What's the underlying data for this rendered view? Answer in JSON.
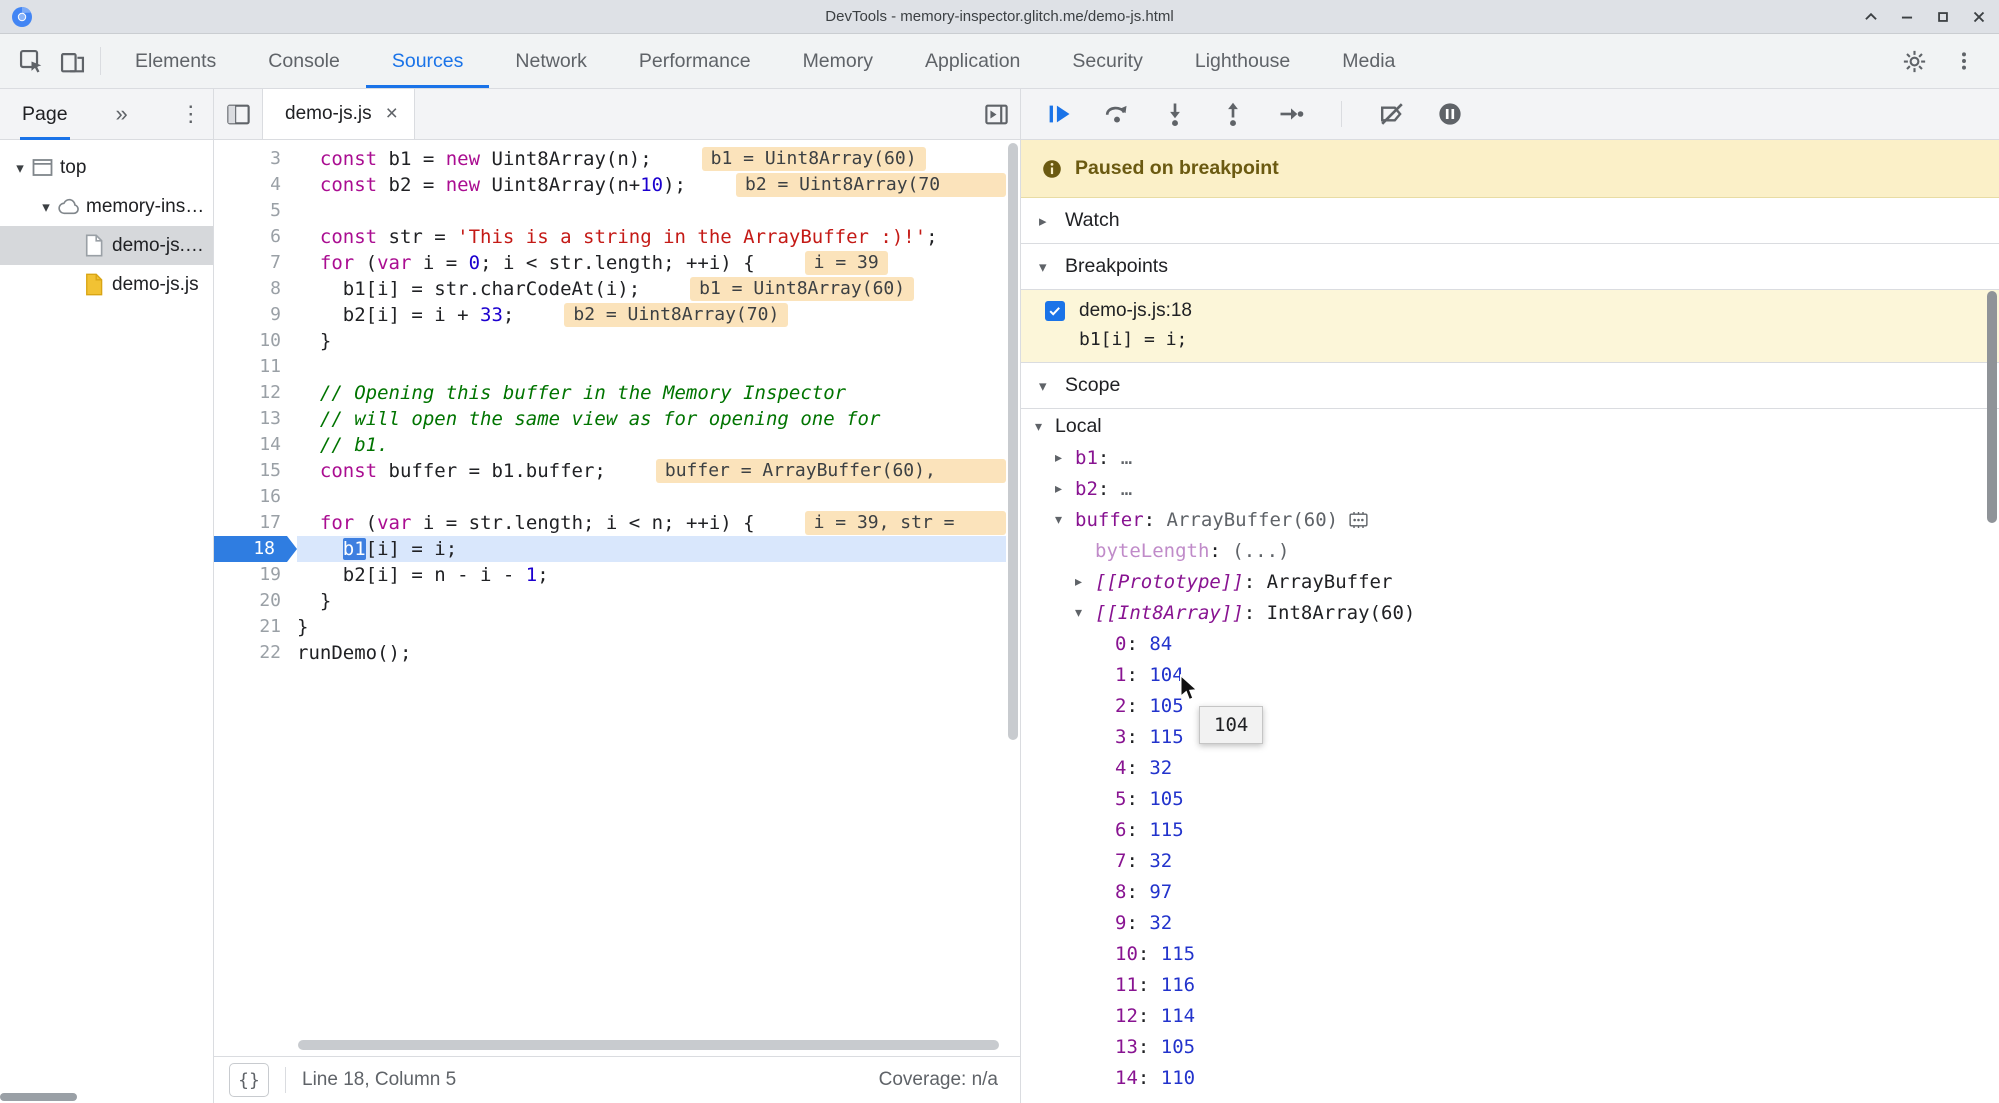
{
  "window": {
    "title": "DevTools - memory-inspector.glitch.me/demo-js.html",
    "controls": [
      "keep-on-top-icon",
      "minimize-icon",
      "maximize-icon",
      "close-icon"
    ]
  },
  "colors": {
    "accent": "#1a73e8",
    "keyword": "#aa0d91",
    "number": "#1c00cf",
    "string": "#c41a16",
    "comment": "#007400",
    "badge_bg": "#fbe3bb",
    "paused_bg": "#fbf0c8",
    "paused_text": "#6b5a11",
    "breakpoint_bg": "#fcf6d9",
    "current_line_bg": "#d9e7fc",
    "selection_bg": "#3e7fe0",
    "prop_name": "#881391",
    "getter_name": "#c08bc9",
    "value_number": "#2233cc",
    "selected_row_bg": "#d6d8db"
  },
  "toolbar": {
    "left_icons": [
      "inspect-icon",
      "device-toolbar-icon"
    ],
    "tabs": [
      {
        "label": "Elements"
      },
      {
        "label": "Console"
      },
      {
        "label": "Sources",
        "active": true
      },
      {
        "label": "Network"
      },
      {
        "label": "Performance"
      },
      {
        "label": "Memory"
      },
      {
        "label": "Application"
      },
      {
        "label": "Security"
      },
      {
        "label": "Lighthouse"
      },
      {
        "label": "Media"
      }
    ],
    "right_icons": [
      "settings-icon",
      "more-menu-icon"
    ]
  },
  "navigator": {
    "tab": "Page",
    "more": "»",
    "menu": "⋮",
    "tree": [
      {
        "label": "top",
        "depth": 0,
        "icon": "frame-icon",
        "expanded": true
      },
      {
        "label": "memory-inspector.glitch.me",
        "depth": 1,
        "icon": "cloud-icon",
        "expanded": true
      },
      {
        "label": "demo-js.html",
        "depth": 2,
        "icon": "file-html-icon",
        "selected": true
      },
      {
        "label": "demo-js.js",
        "depth": 2,
        "icon": "file-js-icon"
      }
    ]
  },
  "editor": {
    "tab": {
      "label": "demo-js.js",
      "close": "×"
    },
    "status": {
      "pretty": "{}",
      "position": "Line 18, Column 5",
      "coverage": "Coverage: n/a"
    },
    "lines": [
      {
        "n": 3,
        "s": [
          [
            "pl",
            "  "
          ],
          [
            "kw",
            "const"
          ],
          [
            "pl",
            " b1 = "
          ],
          [
            "kw",
            "new"
          ],
          [
            "pl",
            " Uint8Array(n);"
          ]
        ],
        "b": "b1 = Uint8Array(60)"
      },
      {
        "n": 4,
        "s": [
          [
            "pl",
            "  "
          ],
          [
            "kw",
            "const"
          ],
          [
            "pl",
            " b2 = "
          ],
          [
            "kw",
            "new"
          ],
          [
            "pl",
            " Uint8Array(n+"
          ],
          [
            "num",
            "10"
          ],
          [
            "pl",
            ");"
          ]
        ],
        "b": "b2 = Uint8Array(70",
        "cut": true
      },
      {
        "n": 5,
        "s": []
      },
      {
        "n": 6,
        "s": [
          [
            "pl",
            "  "
          ],
          [
            "kw",
            "const"
          ],
          [
            "pl",
            " str = "
          ],
          [
            "str",
            "'This is a string in the ArrayBuffer :)!'"
          ],
          [
            "pl",
            ";"
          ]
        ]
      },
      {
        "n": 7,
        "s": [
          [
            "pl",
            "  "
          ],
          [
            "kw",
            "for"
          ],
          [
            "pl",
            " ("
          ],
          [
            "kw",
            "var"
          ],
          [
            "pl",
            " i = "
          ],
          [
            "num",
            "0"
          ],
          [
            "pl",
            "; i < str.length; ++i) {"
          ]
        ],
        "b": "i = 39"
      },
      {
        "n": 8,
        "s": [
          [
            "pl",
            "    b1[i] = str.charCodeAt(i);"
          ]
        ],
        "b": "b1 = Uint8Array(60)"
      },
      {
        "n": 9,
        "s": [
          [
            "pl",
            "    b2[i] = i + "
          ],
          [
            "num",
            "33"
          ],
          [
            "pl",
            ";"
          ]
        ],
        "b": "b2 = Uint8Array(70)"
      },
      {
        "n": 10,
        "s": [
          [
            "pl",
            "  }"
          ]
        ]
      },
      {
        "n": 11,
        "s": []
      },
      {
        "n": 12,
        "s": [
          [
            "com",
            "  // Opening this buffer in the Memory Inspector"
          ]
        ]
      },
      {
        "n": 13,
        "s": [
          [
            "com",
            "  // will open the same view as for opening one for"
          ]
        ]
      },
      {
        "n": 14,
        "s": [
          [
            "com",
            "  // b1."
          ]
        ]
      },
      {
        "n": 15,
        "s": [
          [
            "pl",
            "  "
          ],
          [
            "kw",
            "const"
          ],
          [
            "pl",
            " buffer = b1.buffer;"
          ]
        ],
        "b": "buffer = ArrayBuffer(60),",
        "cut": true
      },
      {
        "n": 16,
        "s": []
      },
      {
        "n": 17,
        "s": [
          [
            "pl",
            "  "
          ],
          [
            "kw",
            "for"
          ],
          [
            "pl",
            " ("
          ],
          [
            "kw",
            "var"
          ],
          [
            "pl",
            " i = str.length; i < n; ++i) {"
          ]
        ],
        "b": "i = 39, str =",
        "cut": true
      },
      {
        "n": 18,
        "cur": true,
        "s": [
          [
            "pl",
            "    "
          ],
          [
            "sel",
            "b1"
          ],
          [
            "pl",
            "[i] = i;"
          ]
        ]
      },
      {
        "n": 19,
        "s": [
          [
            "pl",
            "    b2[i] = n - i - "
          ],
          [
            "num",
            "1"
          ],
          [
            "pl",
            ";"
          ]
        ]
      },
      {
        "n": 20,
        "s": [
          [
            "pl",
            "  }"
          ]
        ]
      },
      {
        "n": 21,
        "s": [
          [
            "pl",
            "}"
          ]
        ]
      },
      {
        "n": 22,
        "s": [
          [
            "pl",
            "runDemo();"
          ]
        ]
      }
    ]
  },
  "debugger": {
    "toolbar": [
      "resume-icon",
      "step-over-icon",
      "step-into-icon",
      "step-out-icon",
      "step-icon",
      "separator",
      "deactivate-breakpoints-icon",
      "pause-exceptions-icon"
    ],
    "paused_message": "Paused on breakpoint",
    "sections": {
      "watch": "Watch",
      "breakpoints": "Breakpoints",
      "scope": "Scope"
    },
    "breakpoint": {
      "location": "demo-js.js:18",
      "code": "b1[i] = i;",
      "checked": true
    },
    "tooltip": "104",
    "scope": {
      "items": [
        {
          "depth": 0,
          "arrow": "down",
          "name": "Local",
          "kind": "title"
        },
        {
          "depth": 1,
          "arrow": "right",
          "name": "b1",
          "value": "…",
          "kind": "prop"
        },
        {
          "depth": 1,
          "arrow": "right",
          "name": "b2",
          "value": "…",
          "kind": "prop"
        },
        {
          "depth": 1,
          "arrow": "down",
          "name": "buffer",
          "value": "ArrayBuffer(60)",
          "kind": "prop",
          "icon": "memory-inspector-icon"
        },
        {
          "depth": 2,
          "arrow": "",
          "name": "byteLength",
          "value": "(...)",
          "kind": "getter"
        },
        {
          "depth": 2,
          "arrow": "right",
          "name": "[[Prototype]]",
          "value": "ArrayBuffer",
          "kind": "internal"
        },
        {
          "depth": 2,
          "arrow": "down",
          "name": "[[Int8Array]]",
          "value": "Int8Array(60)",
          "kind": "internal"
        },
        {
          "depth": 3,
          "arrow": "",
          "name": "0",
          "value": "84",
          "kind": "index"
        },
        {
          "depth": 3,
          "arrow": "",
          "name": "1",
          "value": "104",
          "kind": "index"
        },
        {
          "depth": 3,
          "arrow": "",
          "name": "2",
          "value": "105",
          "kind": "index"
        },
        {
          "depth": 3,
          "arrow": "",
          "name": "3",
          "value": "115",
          "kind": "index"
        },
        {
          "depth": 3,
          "arrow": "",
          "name": "4",
          "value": "32",
          "kind": "index"
        },
        {
          "depth": 3,
          "arrow": "",
          "name": "5",
          "value": "105",
          "kind": "index"
        },
        {
          "depth": 3,
          "arrow": "",
          "name": "6",
          "value": "115",
          "kind": "index"
        },
        {
          "depth": 3,
          "arrow": "",
          "name": "7",
          "value": "32",
          "kind": "index"
        },
        {
          "depth": 3,
          "arrow": "",
          "name": "8",
          "value": "97",
          "kind": "index"
        },
        {
          "depth": 3,
          "arrow": "",
          "name": "9",
          "value": "32",
          "kind": "index"
        },
        {
          "depth": 3,
          "arrow": "",
          "name": "10",
          "value": "115",
          "kind": "index"
        },
        {
          "depth": 3,
          "arrow": "",
          "name": "11",
          "value": "116",
          "kind": "index"
        },
        {
          "depth": 3,
          "arrow": "",
          "name": "12",
          "value": "114",
          "kind": "index"
        },
        {
          "depth": 3,
          "arrow": "",
          "name": "13",
          "value": "105",
          "kind": "index"
        },
        {
          "depth": 3,
          "arrow": "",
          "name": "14",
          "value": "110",
          "kind": "index"
        }
      ]
    }
  }
}
